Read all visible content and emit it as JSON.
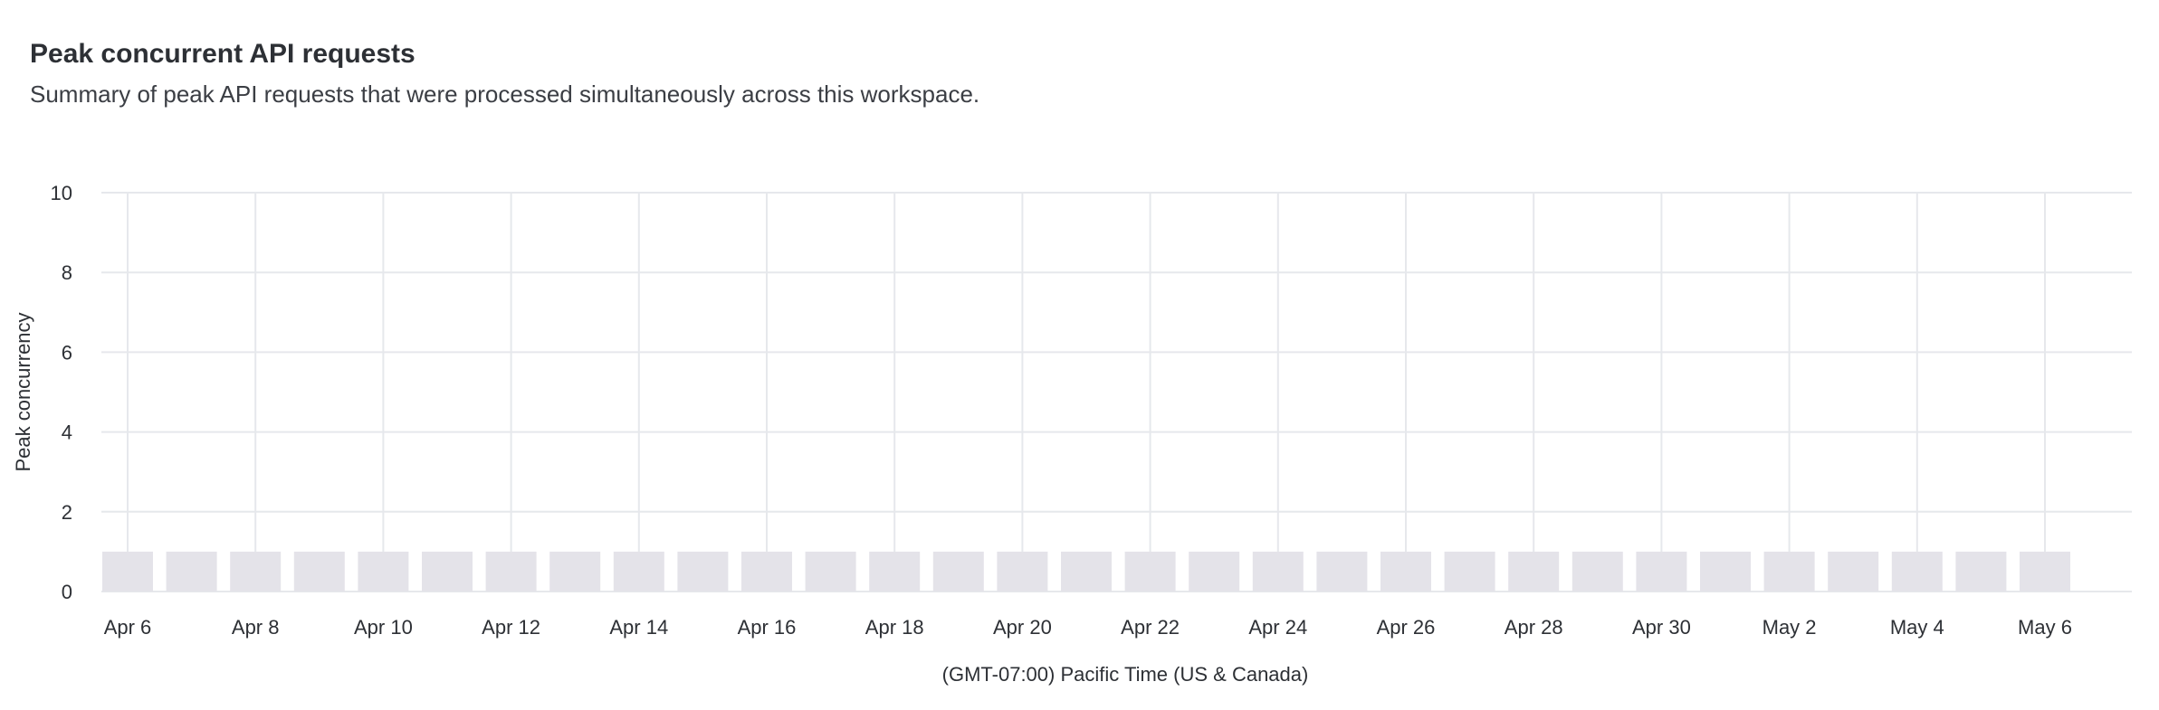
{
  "header": {
    "title": "Peak concurrent API requests",
    "subtitle": "Summary of peak API requests that were processed simultaneously across this workspace."
  },
  "chart_data": {
    "type": "bar",
    "title": "Peak concurrent API requests",
    "subtitle": "Summary of peak API requests that were processed simultaneously across this workspace.",
    "xlabel": "(GMT-07:00) Pacific Time (US & Canada)",
    "ylabel": "Peak concurrency",
    "ylim": [
      0,
      10
    ],
    "yticks": [
      0,
      2,
      4,
      6,
      8,
      10
    ],
    "grid": true,
    "bar_color": "#e4e3e9",
    "grid_color": "#e6e8ec",
    "categories": [
      "Apr 6",
      "Apr 7",
      "Apr 8",
      "Apr 9",
      "Apr 10",
      "Apr 11",
      "Apr 12",
      "Apr 13",
      "Apr 14",
      "Apr 15",
      "Apr 16",
      "Apr 17",
      "Apr 18",
      "Apr 19",
      "Apr 20",
      "Apr 21",
      "Apr 22",
      "Apr 23",
      "Apr 24",
      "Apr 25",
      "Apr 26",
      "Apr 27",
      "Apr 28",
      "Apr 29",
      "Apr 30",
      "May 1",
      "May 2",
      "May 3",
      "May 4",
      "May 5",
      "May 6"
    ],
    "tick_labels": [
      "Apr 6",
      "Apr 8",
      "Apr 10",
      "Apr 12",
      "Apr 14",
      "Apr 16",
      "Apr 18",
      "Apr 20",
      "Apr 22",
      "Apr 24",
      "Apr 26",
      "Apr 28",
      "Apr 30",
      "May 2",
      "May 4",
      "May 6"
    ],
    "values": [
      1,
      1,
      1,
      1,
      1,
      1,
      1,
      1,
      1,
      1,
      1,
      1,
      1,
      1,
      1,
      1,
      1,
      1,
      1,
      1,
      1,
      1,
      1,
      1,
      1,
      1,
      1,
      1,
      1,
      1,
      1
    ]
  }
}
